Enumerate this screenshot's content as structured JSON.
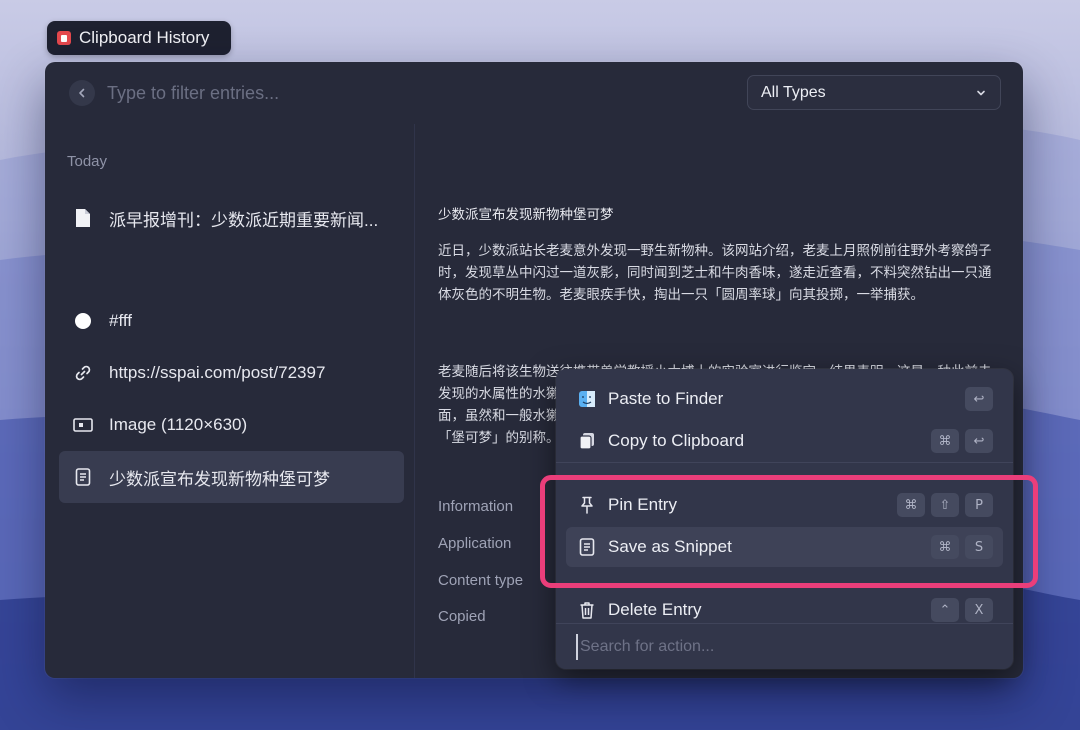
{
  "app": {
    "title": "Clipboard History"
  },
  "search": {
    "placeholder": "Type to filter entries..."
  },
  "filter": {
    "selected": "All Types"
  },
  "sidebar": {
    "section": "Today",
    "items": [
      {
        "label": "派早报增刊：少数派近期重要新闻...",
        "icon": "document-icon"
      },
      {
        "label": "#fff",
        "icon": "color-swatch-icon"
      },
      {
        "label": "https://sspai.com/post/72397",
        "icon": "link-icon"
      },
      {
        "label": "Image (1120×630)",
        "icon": "image-icon"
      },
      {
        "label": "少数派宣布发现新物种堡可梦",
        "icon": "text-icon"
      }
    ]
  },
  "content": {
    "title": "少数派宣布发现新物种堡可梦",
    "para1": "近日，少数派站长老麦意外发现一野生新物种。该网站介绍，老麦上月照例前往野外考察鸽子时，发现草丛中闪过一道灰影，同时闻到芝士和牛肉香味，遂走近查看，不料突然钻出一只通体灰色的不明生物。老麦眼疾手快，掏出一只「圆周率球」向其投掷，一举捕获。",
    "para2": "老麦随后将该生物送往携带兽学教授小木博士的实验室进行鉴定。结果表明，这是一种此前未发现的水属性的水獭类宝可梦。其性格特点为活泼好动，以悠闲摸鱼作为自身的信条。习性方面，虽然和一般水獭一样以鱼、蛙、蟹和贝类为食，但除此之外尤其嗜食汉堡，因此又获得了「堡可梦」的别称。",
    "info_labels": [
      "Information",
      "Application",
      "Content type",
      "Copied"
    ]
  },
  "menu": {
    "items": [
      {
        "label": "Paste to Finder",
        "icon": "finder-icon",
        "keys": [
          "↩"
        ]
      },
      {
        "label": "Copy to Clipboard",
        "icon": "copy-icon",
        "keys": [
          "⌘",
          "↩"
        ]
      },
      {
        "label": "Pin Entry",
        "icon": "pin-icon",
        "keys": [
          "⌘",
          "⇧",
          "P"
        ]
      },
      {
        "label": "Save as Snippet",
        "icon": "snippet-icon",
        "keys": [
          "⌘",
          "S"
        ]
      },
      {
        "label": "Delete Entry",
        "icon": "trash-icon",
        "keys": [
          "⌃",
          "X"
        ]
      }
    ],
    "search_placeholder": "Search for action..."
  },
  "colors": {
    "highlight": "#ea3e7a",
    "window_bg": "#272a3a",
    "menu_bg": "#32364a"
  }
}
